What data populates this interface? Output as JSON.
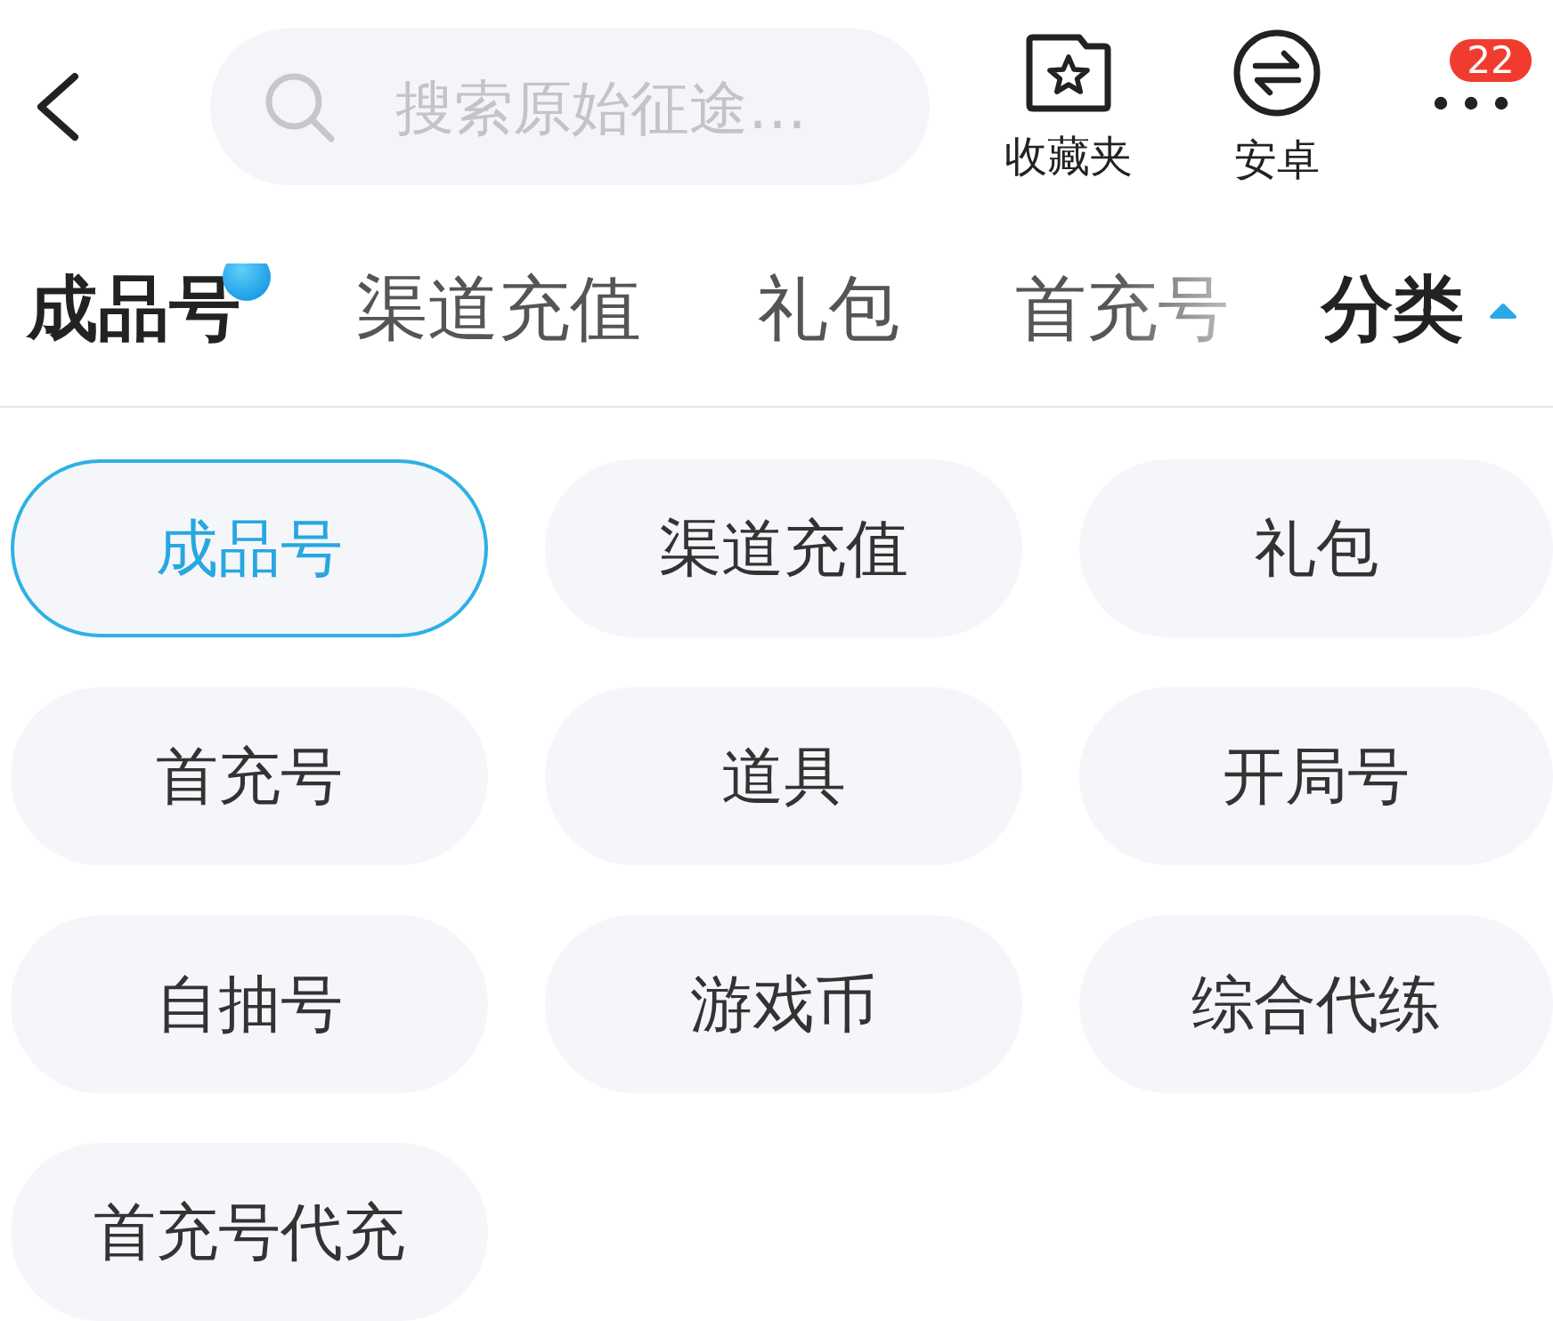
{
  "top_bar": {
    "search": {
      "placeholder": "搜索原始征途…"
    },
    "actions": [
      {
        "kind": "favorites",
        "label": "收藏夹"
      },
      {
        "kind": "android",
        "label": "安卓"
      },
      {
        "kind": "more",
        "badge": "22"
      }
    ]
  },
  "tabs": [
    {
      "label": "成品号",
      "selected": true,
      "dot": true
    },
    {
      "label": "渠道充值",
      "selected": false,
      "dot": false
    },
    {
      "label": "礼包",
      "selected": false,
      "dot": false
    },
    {
      "label": "首充号",
      "selected": false,
      "dot": false
    }
  ],
  "category_toggle": {
    "label": "分类",
    "expanded": true
  },
  "categories": [
    {
      "label": "成品号",
      "selected": true
    },
    {
      "label": "渠道充值",
      "selected": false
    },
    {
      "label": "礼包",
      "selected": false
    },
    {
      "label": "首充号",
      "selected": false
    },
    {
      "label": "道具",
      "selected": false
    },
    {
      "label": "开局号",
      "selected": false
    },
    {
      "label": "自抽号",
      "selected": false
    },
    {
      "label": "游戏币",
      "selected": false
    },
    {
      "label": "综合代练",
      "selected": false
    },
    {
      "label": "首充号代充",
      "selected": false
    }
  ]
}
